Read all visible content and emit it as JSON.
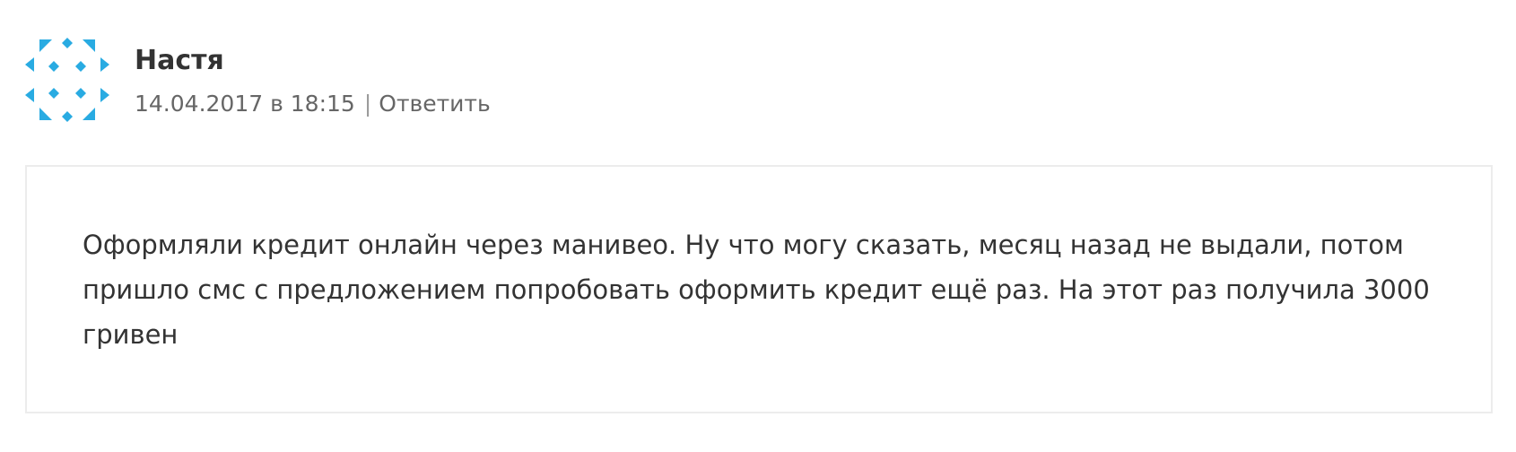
{
  "comment": {
    "author": "Настя",
    "date": "14.04.2017 в 18:15",
    "separator": "|",
    "reply_label": "Ответить",
    "avatar_icon": "identicon-avatar-icon",
    "avatar_color": "#29abe2",
    "text": "Оформляли кредит онлайн через манивео. Ну что могу сказать, месяц назад не выдали, потом пришло смс с предложением попробовать оформить кредит ещё раз. На этот раз получила 3000 гривен"
  }
}
